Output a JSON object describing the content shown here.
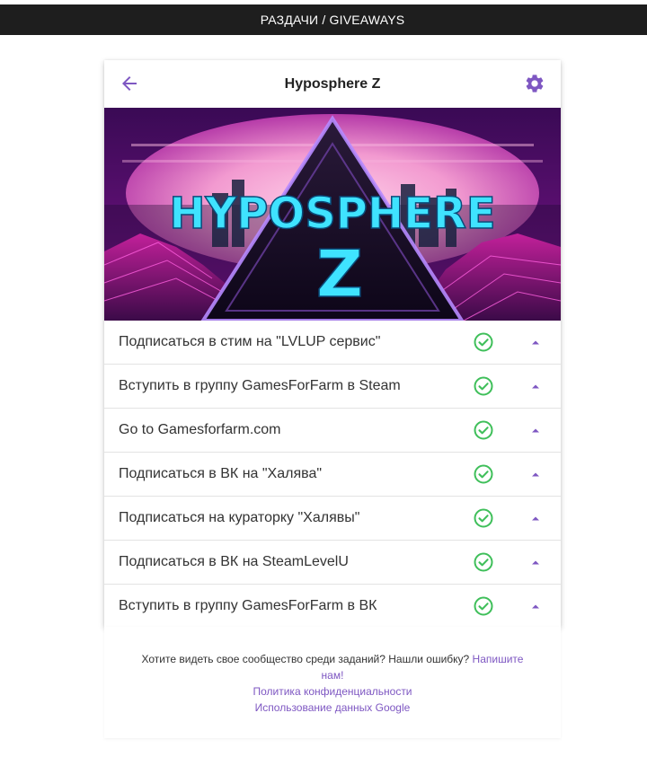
{
  "topbar": {
    "title": "РАЗДАЧИ / GIVEAWAYS"
  },
  "card": {
    "title": "Hyposphere Z",
    "banner": {
      "line1": "HYPOSPHERE",
      "line2": "Z"
    },
    "tasks": [
      {
        "label": "Подписаться в стим на \"LVLUP сервис\"",
        "done": true
      },
      {
        "label": "Вступить в группу GamesForFarm в Steam",
        "done": true
      },
      {
        "label": "Go to Gamesforfarm.com",
        "done": true
      },
      {
        "label": "Подписаться в ВК на \"Халява\"",
        "done": true
      },
      {
        "label": "Подписаться на кураторку \"Халявы\"",
        "done": true
      },
      {
        "label": "Подписаться в ВК на SteamLevelU",
        "done": true
      },
      {
        "label": "Вступить в группу GamesForFarm в ВК",
        "done": true
      }
    ]
  },
  "footer": {
    "question": "Хотите видеть свое сообщество среди заданий? Нашли ошибку? ",
    "write_us": "Напишите нам!",
    "privacy": "Политика конфиденциальности",
    "google_data": "Использование данных Google"
  },
  "colors": {
    "accent": "#7e57c2",
    "check": "#3fbf5a",
    "topbar_bg": "#1e1e1e"
  },
  "icons": {
    "back": "arrow-left-icon",
    "settings": "gear-icon",
    "done": "check-circle-icon",
    "expand": "chevron-up-icon"
  }
}
